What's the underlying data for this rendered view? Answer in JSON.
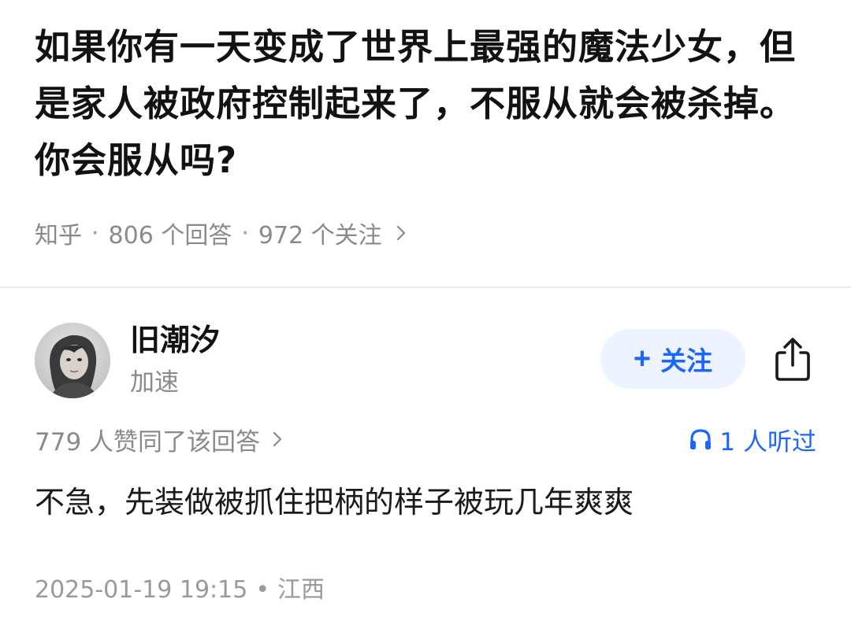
{
  "question": {
    "title": "如果你有一天变成了世界上最强的魔法少女，但是家人被政府控制起来了，不服从就会被杀掉。你会服从吗?",
    "meta": {
      "source": "知乎",
      "separator": "·",
      "answers": "806 个回答",
      "followers": "972 个关注"
    }
  },
  "answer": {
    "author": {
      "name": "旧潮汐",
      "subtitle": "加速",
      "avatar_icon": "avatar-photo"
    },
    "follow_button": {
      "plus": "+",
      "label": "关注"
    },
    "share_icon": "share-icon",
    "likes": "779 人赞同了该回答",
    "listens": "1 人听过",
    "content": "不急，先装做被抓住把柄的样子被玩几年爽爽",
    "timestamp": "2025-01-19 19:15",
    "footer_separator": "•",
    "location": "江西"
  },
  "colors": {
    "accent": "#1a66ff",
    "muted": "#8a8a8a",
    "follow_bg": "#eef4ff"
  }
}
